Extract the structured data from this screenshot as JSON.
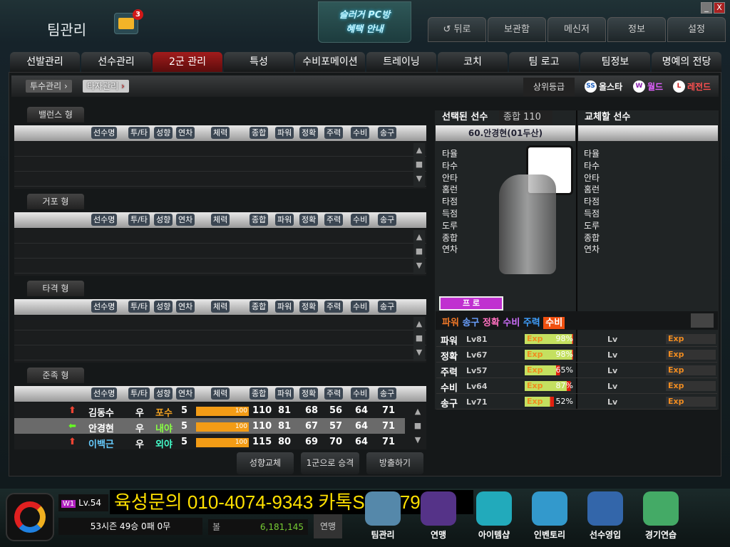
{
  "header": {
    "title": "팀관리",
    "mail_count": "3",
    "promo_line1": "슬러거 PC방",
    "promo_line2": "혜택 안내",
    "nav": [
      "뒤로",
      "보관함",
      "메신저",
      "정보",
      "설정"
    ],
    "minimize": "_",
    "close": "X"
  },
  "tabs": [
    "선발관리",
    "선수관리",
    "2군 관리",
    "특성",
    "수비포메이션",
    "트레이닝",
    "코치",
    "팀 로고",
    "팀정보",
    "명예의 전당"
  ],
  "active_tab": "2군 관리",
  "subtabs": [
    "투수관리",
    "타자관리"
  ],
  "grades": {
    "label": "상위등급",
    "allstar": "올스타",
    "allstar_badge": "SS",
    "world": "월드",
    "world_badge": "W",
    "legend": "레전드",
    "legend_badge": "L"
  },
  "columns": [
    "선수명",
    "투/타",
    "성향",
    "연차",
    "체력",
    "종합",
    "파워",
    "정확",
    "주력",
    "수비",
    "송구"
  ],
  "sections": [
    "밸런스 형",
    "거포 형",
    "타격 형",
    "준족 형"
  ],
  "players": [
    {
      "name": "김동수",
      "hand": "우",
      "pos": "포수",
      "year": "5",
      "stamina": "100",
      "total": "110",
      "power": "81",
      "contact": "68",
      "speed": "56",
      "defense": "64",
      "throw": "71"
    },
    {
      "name": "안경현",
      "hand": "우",
      "pos": "내야",
      "year": "5",
      "stamina": "100",
      "total": "110",
      "power": "81",
      "contact": "67",
      "speed": "57",
      "defense": "64",
      "throw": "71"
    },
    {
      "name": "이백근",
      "hand": "우",
      "pos": "외야",
      "year": "5",
      "stamina": "100",
      "total": "115",
      "power": "80",
      "contact": "69",
      "speed": "70",
      "defense": "64",
      "throw": "71"
    }
  ],
  "actions": [
    "성향교체",
    "1군으로 승격",
    "방출하기"
  ],
  "selected": {
    "label": "선택된 선수",
    "total_label": "종합",
    "total": "110",
    "name": "60.안경현(01두산)",
    "grade": "프 로",
    "stat_labels": [
      "타율",
      "타수",
      "안타",
      "홈런",
      "타점",
      "득점",
      "도루",
      "종합",
      "연차"
    ],
    "trait_line": [
      "파워",
      "송구",
      "정확",
      "수비",
      "주력"
    ],
    "trait_highlight": "수비",
    "skills": [
      {
        "name": "파워",
        "lv": "Lv81",
        "pct": "98%"
      },
      {
        "name": "정확",
        "lv": "Lv67",
        "pct": "98%"
      },
      {
        "name": "주력",
        "lv": "Lv57",
        "pct": "65%"
      },
      {
        "name": "수비",
        "lv": "Lv64",
        "pct": "87%"
      },
      {
        "name": "송구",
        "lv": "Lv71",
        "pct": "52%"
      }
    ]
  },
  "replace": {
    "label": "교체할 선수",
    "lv": "Lv",
    "exp": "Exp"
  },
  "exp_label": "Exp",
  "footer": {
    "rank": "W1",
    "level": "Lv.54",
    "record": "53시즌  49승  0패  0무",
    "money_label": "볼",
    "money": "6,181,145",
    "league_btn": "연맹",
    "ad": "육성문의 010-4074-9343 카톡SG7979",
    "menu": [
      "팀관리",
      "연맹",
      "아이템샵",
      "인벤토리",
      "선수영입",
      "경기연습"
    ]
  }
}
